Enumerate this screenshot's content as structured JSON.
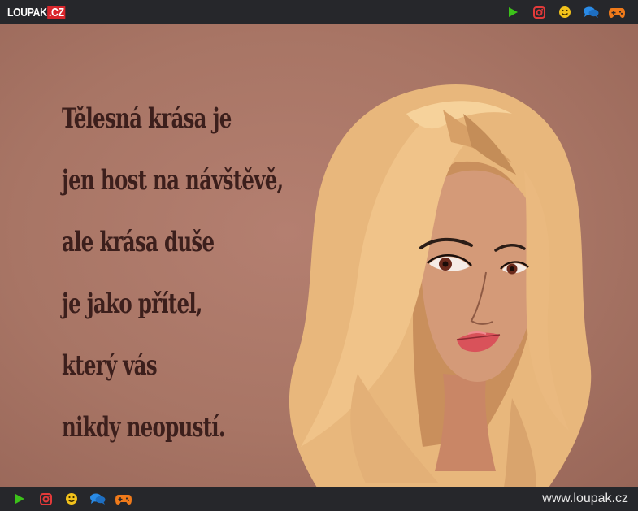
{
  "header": {
    "logo_main": "LOUPAK",
    "logo_tld": ".CZ",
    "icons": [
      "play-icon",
      "instagram-icon",
      "smiley-icon",
      "chat-icon",
      "gamepad-icon"
    ]
  },
  "colors": {
    "bar": "#26272b",
    "background": "#b07a6b",
    "text": "#3c1f1c",
    "play": "#3cc21a",
    "instagram": "#e33a3a",
    "smiley": "#f2c21b",
    "chat": "#2a8be6",
    "gamepad": "#f07a1a"
  },
  "quote": {
    "lines": [
      "Tělesná krása je",
      "jen host na návštěvě,",
      "ale krása duše",
      "je jako přítel,",
      "který vás",
      "nikdy neopustí."
    ]
  },
  "footer": {
    "url": "www.loupak.cz",
    "icons": [
      "play-icon",
      "instagram-icon",
      "smiley-icon",
      "chat-icon",
      "gamepad-icon"
    ]
  }
}
